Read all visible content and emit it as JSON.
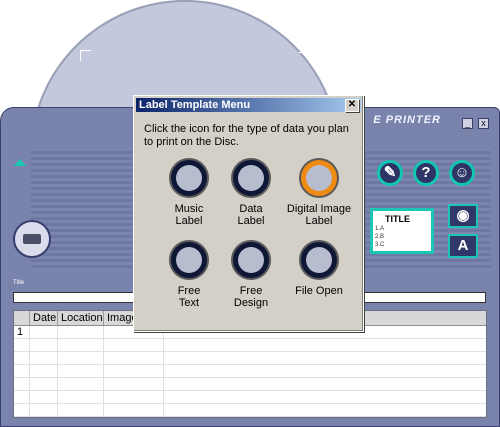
{
  "app": {
    "title_fragment": "E PRINTER",
    "minimize_label": "_",
    "close_label": "x",
    "field_label": "Title",
    "preview": {
      "title": "TITLE",
      "rows": [
        "1.A",
        "2.B",
        "3.C"
      ]
    },
    "tool_icons": [
      "wrench-icon",
      "help-icon",
      "user-support-icon"
    ],
    "side_buttons": [
      "eye-icon",
      "font-icon"
    ],
    "font_button_label": "A",
    "help_button_label": "?"
  },
  "table": {
    "columns": [
      "Date",
      "Location",
      "Image"
    ],
    "rows": [
      {
        "num": "1"
      }
    ]
  },
  "dialog": {
    "title": "Label Template Menu",
    "close_label": "✕",
    "instruction": "Click the icon for the type of data you plan to print on the Disc.",
    "options": [
      {
        "label_1": "Music",
        "label_2": "Label",
        "icon": "music-note-icon"
      },
      {
        "label_1": "Data",
        "label_2": "Label",
        "icon": "data-icon"
      },
      {
        "label_1": "Digital Image",
        "label_2": "Label",
        "icon": "camera-icon"
      },
      {
        "label_1": "Free",
        "label_2": "Text",
        "icon": "text-icon"
      },
      {
        "label_1": "Free",
        "label_2": "Design",
        "icon": "design-icon"
      },
      {
        "label_1": "File Open",
        "label_2": "",
        "icon": "folder-open-icon"
      }
    ]
  },
  "colors": {
    "accent": "#1ac7b4",
    "app_bg": "#7a83ab",
    "highlight": "#ef8a12"
  }
}
